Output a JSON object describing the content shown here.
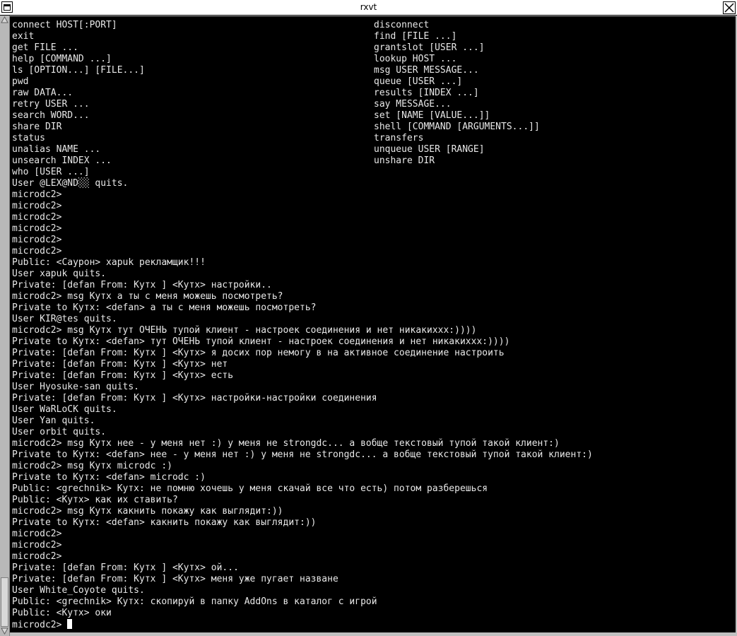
{
  "window": {
    "title": "rxvt"
  },
  "terminal": {
    "help_left": [
      "connect HOST[:PORT]",
      "exit",
      "get FILE ...",
      "help [COMMAND ...]",
      "ls [OPTION...] [FILE...]",
      "pwd",
      "raw DATA...",
      "retry USER ...",
      "search WORD...",
      "share DIR",
      "status",
      "unalias NAME ...",
      "unsearch INDEX ...",
      "who [USER ...]"
    ],
    "help_right": [
      "disconnect",
      "find [FILE ...]",
      "grantslot [USER ...]",
      "lookup HOST ...",
      "msg USER MESSAGE...",
      "queue [USER ...]",
      "results [INDEX ...]",
      "say MESSAGE...",
      "set [NAME [VALUE...]]",
      "shell [COMMAND [ARGUMENTS...]]",
      "transfers",
      "unqueue USER [RANGE]",
      "unshare DIR"
    ],
    "log": [
      "User @LEX@ND░░ quits.",
      "microdc2>",
      "microdc2>",
      "microdc2>",
      "microdc2>",
      "microdc2>",
      "microdc2>",
      "Public: <Саурон> xapuk рекламщик!!!",
      "User xapuk quits.",
      "Private: [defan From: Кутх ] <Кутх> настройки..",
      "microdc2> msg Кутх а ты с меня можешь посмотреть?",
      "Private to Кутх: <defan> а ты с меня можешь посмотреть?",
      "User KIR@tes quits.",
      "microdc2> msg Кутх тут ОЧЕНЬ тупой клиент - настроек соединения и нет никакихxx:))))",
      "Private to Кутх: <defan> тут ОЧЕНЬ тупой клиент - настроек соединения и нет никакихxx:))))",
      "Private: [defan From: Кутх ] <Кутх> я досих пор немогу в на активное соединение настроить",
      "Private: [defan From: Кутх ] <Кутх> нет",
      "Private: [defan From: Кутх ] <Кутх> есть",
      "User Hyosuke-san quits.",
      "Private: [defan From: Кутх ] <Кутх> настройки-настройки соединения",
      "User WaRLoCK quits.",
      "User Yan quits.",
      "User orbit quits.",
      "microdc2> msg Кутх нее - у меня нет :) у меня не strongdc... а вобще текстовый тупой такой клиент:)",
      "Private to Кутх: <defan> нее - у меня нет :) у меня не strongdc... а вобще текстовый тупой такой клиент:)",
      "microdc2> msg Кутх microdc :)",
      "Private to Кутх: <defan> microdc :)",
      "Public: <grechnik> Кутх: не помню хочешь у меня скачай все что есть) потом разберешься",
      "Public: <Кутх> как их ставить?",
      "microdc2> msg Кутх какнить покажу как выглядит:))",
      "Private to Кутх: <defan> какнить покажу как выглядит:))",
      "microdc2>",
      "microdc2>",
      "microdc2>",
      "Private: [defan From: Кутх ] <Кутх> ой...",
      "Private: [defan From: Кутх ] <Кутх> меня уже пугает назване",
      "User White_Coyote quits.",
      "Public: <grechnik> Кутх: скопируй в папку AddOns в каталог с игрой",
      "Public: <Кутх> оки"
    ],
    "prompt": "microdc2>"
  }
}
